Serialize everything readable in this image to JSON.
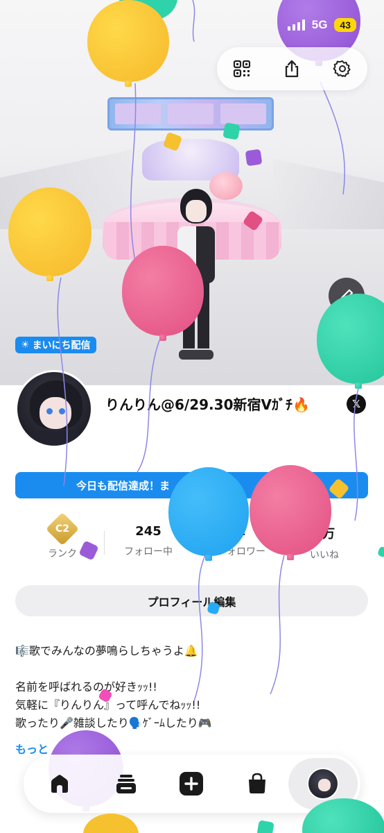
{
  "status_bar": {
    "network": "5G",
    "battery": "43"
  },
  "toolbar": {
    "items": [
      "qr-code",
      "share",
      "settings"
    ]
  },
  "daily_tag": {
    "icon": "☀",
    "label": "まいにち配信"
  },
  "profile": {
    "display_name": "りんりん@6/29.30新宿Vｶﾞﾁ🔥",
    "social": "𝕏"
  },
  "streak_banner": {
    "text": "今日も配信達成！ま　　　　　　　　　　26"
  },
  "stats": {
    "rank": {
      "badge": "C2",
      "label": "ランク"
    },
    "following": {
      "value": "245",
      "label": "フォロー中"
    },
    "followers": {
      "value": "1",
      "label": "フォロワー"
    },
    "likes": {
      "value": "9万",
      "label": "いいね"
    }
  },
  "edit_profile_label": "プロフィール編集",
  "bio": {
    "line1": "🎼歌でみんなの夢鳴らしちゃうよ🔔",
    "line2": "名前を呼ばれるのが好きｯｯ!!",
    "line3": "気軽に『りんりん』って呼んでねｯｯ!!",
    "line4": "歌ったり🎤雑談したり🗣️ｹﾞｰﾑしたり🎮",
    "more": "もっと"
  },
  "bottom_nav": [
    "home",
    "timeline",
    "create",
    "shop",
    "me"
  ],
  "colors": {
    "accent_blue": "#1a8cf0",
    "balloon_yellow": "#fbc02d",
    "balloon_pink": "#ec5f8f",
    "balloon_teal": "#2fd3a9",
    "balloon_purple": "#9b5bd8",
    "balloon_blue": "#27aaf5"
  }
}
